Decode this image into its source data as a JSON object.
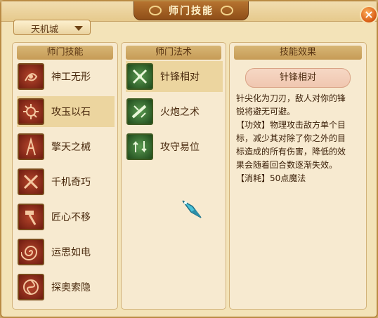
{
  "window": {
    "title": "师门技能",
    "close_icon": "close-icon"
  },
  "dropdown": {
    "selected": "天机城"
  },
  "panels": {
    "skills_header": "师门技能",
    "spells_header": "师门法术",
    "effect_header": "技能效果"
  },
  "skills": [
    {
      "label": "神工无形",
      "icon": "swirl-rune-icon"
    },
    {
      "label": "攻玉以石",
      "icon": "gear-rune-icon"
    },
    {
      "label": "擎天之械",
      "icon": "pillar-rune-icon"
    },
    {
      "label": "千机奇巧",
      "icon": "cross-tools-icon"
    },
    {
      "label": "匠心不移",
      "icon": "hammer-icon"
    },
    {
      "label": "运思如电",
      "icon": "spiral-icon"
    },
    {
      "label": "探奥索隐",
      "icon": "vortex-icon"
    }
  ],
  "selected_skill_index": 1,
  "spells": [
    {
      "label": "针锋相对",
      "icon": "crossed-blades-icon"
    },
    {
      "label": "火炮之术",
      "icon": "cannon-icon"
    },
    {
      "label": "攻守易位",
      "icon": "swap-arrows-icon"
    }
  ],
  "selected_spell_index": 0,
  "effect": {
    "name": "针锋相对",
    "description": "针尖化为刀刃，敌人对你的锋\n锐将避无可避。\n【功效】物理攻击敌方单个目\n标，减少其对除了你之外的目\n标造成的所有伤害，降低的效\n果会随着回合数逐渐失效。\n【消耗】50点魔法"
  },
  "cursor_icon": "crystal-cursor-icon"
}
